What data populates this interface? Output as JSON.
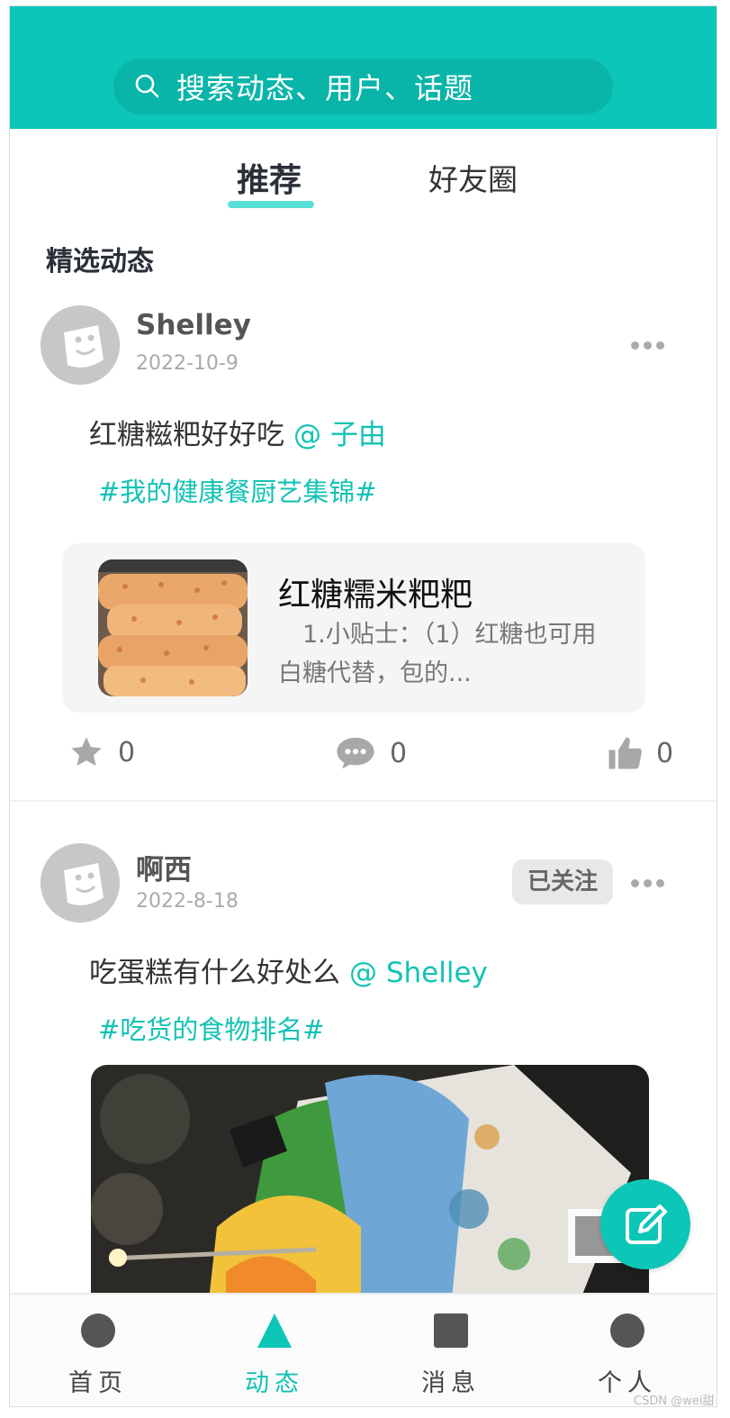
{
  "search": {
    "placeholder": "搜索动态、用户、话题",
    "icon": "search-icon"
  },
  "tabs": [
    {
      "label": "推荐",
      "active": true
    },
    {
      "label": "好友圈",
      "active": false
    }
  ],
  "section_title": "精选动态",
  "posts": [
    {
      "username": "Shelley",
      "date": "2022-10-9",
      "text": "红糖糍粑好好吃",
      "mention": "@ 子由",
      "topic": "#我的健康餐厨艺集锦#",
      "recipe": {
        "title": "红糖糯米粑粑",
        "desc": "　1.小贴士：（1）红糖也可用白糖代替，包的..."
      },
      "stats": {
        "favorites": "0",
        "comments": "0",
        "likes": "0"
      }
    },
    {
      "username": "啊西",
      "date": "2022-8-18",
      "follow_label": "已关注",
      "text": "吃蛋糕有什么好处么",
      "mention": "@ Shelley",
      "topic": "#吃货的食物排名#"
    }
  ],
  "bottom_nav": [
    {
      "label": "首页",
      "icon": "circle-icon"
    },
    {
      "label": "动态",
      "icon": "triangle-icon",
      "active": true
    },
    {
      "label": "消息",
      "icon": "square-icon"
    },
    {
      "label": "个人",
      "icon": "circle-icon"
    }
  ],
  "colors": {
    "accent": "#0cc6b8",
    "mention": "#13c2b3"
  },
  "watermark": "CSDN @wei甜"
}
